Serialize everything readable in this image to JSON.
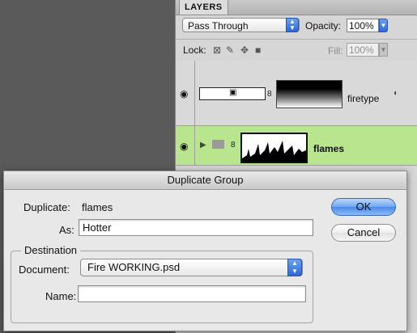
{
  "layers_panel": {
    "tab_label": "LAYERS",
    "blend_mode": "Pass Through",
    "opacity_label": "Opacity:",
    "opacity_value": "100%",
    "lock_label": "Lock:",
    "fill_label": "Fill:",
    "fill_value": "100%",
    "layers": [
      {
        "name": "firetype",
        "visible": true
      },
      {
        "name": "flames",
        "visible": true,
        "selected": true,
        "type": "group"
      }
    ]
  },
  "dialog": {
    "title": "Duplicate Group",
    "duplicate_label": "Duplicate:",
    "duplicate_value": "flames",
    "as_label": "As:",
    "as_value": "Hotter",
    "destination_label": "Destination",
    "document_label": "Document:",
    "document_value": "Fire WORKING.psd",
    "name_label": "Name:",
    "name_value": "",
    "ok_label": "OK",
    "cancel_label": "Cancel"
  },
  "colors": {
    "selected_layer": "#b9e58f",
    "ok_button": "#6fa6ef",
    "workspace": "#5a5a5a"
  }
}
